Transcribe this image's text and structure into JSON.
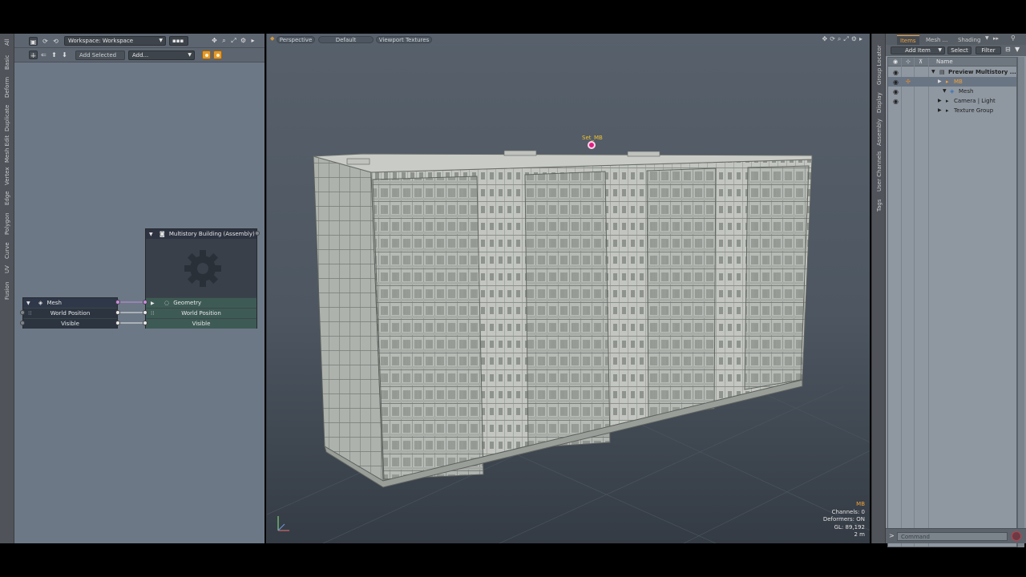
{
  "left_tabs": [
    "All",
    "Basic",
    "Deform",
    "Duplicate",
    "Mesh Edit",
    "Vertex",
    "Edge",
    "Polygon",
    "Curve",
    "UV",
    "Fusion"
  ],
  "schematic": {
    "workspace_select": "Workspace: Workspace",
    "add_selected_label": "Add Selected",
    "add_field": "Add..."
  },
  "nodes": {
    "assembly": {
      "title": "Multistory Building (Assembly)",
      "geometry_label": "Geometry",
      "world_position_label": "World Position",
      "visible_label": "Visible"
    },
    "mesh": {
      "title": "Mesh",
      "world_position_label": "World Position",
      "visible_label": "Visible"
    }
  },
  "viewport": {
    "tabs": [
      "Perspective",
      "Default",
      "Viewport Textures"
    ],
    "selection_label": "Set_MB",
    "info": {
      "title": "MB",
      "channels": "Channels: 0",
      "deformers": "Deformers: ON",
      "gl": "GL: 89,192",
      "scale": "2 m"
    }
  },
  "right_tabs": [
    "Group Locator",
    "Display",
    "Assembly",
    "User Channels",
    "Tags"
  ],
  "items_panel": {
    "tabs": [
      "Items",
      "Mesh ...",
      "Shading"
    ],
    "active_tab": "Items",
    "add_item_label": "Add Item",
    "select_label": "Select",
    "filter_label": "Filter",
    "name_header": "Name",
    "tree": [
      {
        "label": "Preview Multistory ...",
        "indent": 0
      },
      {
        "label": "MB",
        "indent": 1
      },
      {
        "label": "Mesh",
        "indent": 2
      },
      {
        "label": "Camera | Light",
        "indent": 1
      },
      {
        "label": "Texture Group",
        "indent": 1
      }
    ],
    "command_placeholder": "Command"
  },
  "colors": {
    "accent": "#f0a13c",
    "schematic_bg": "#6c7886",
    "node_body": "#3c5656",
    "selection_dot": "#e01f82"
  }
}
